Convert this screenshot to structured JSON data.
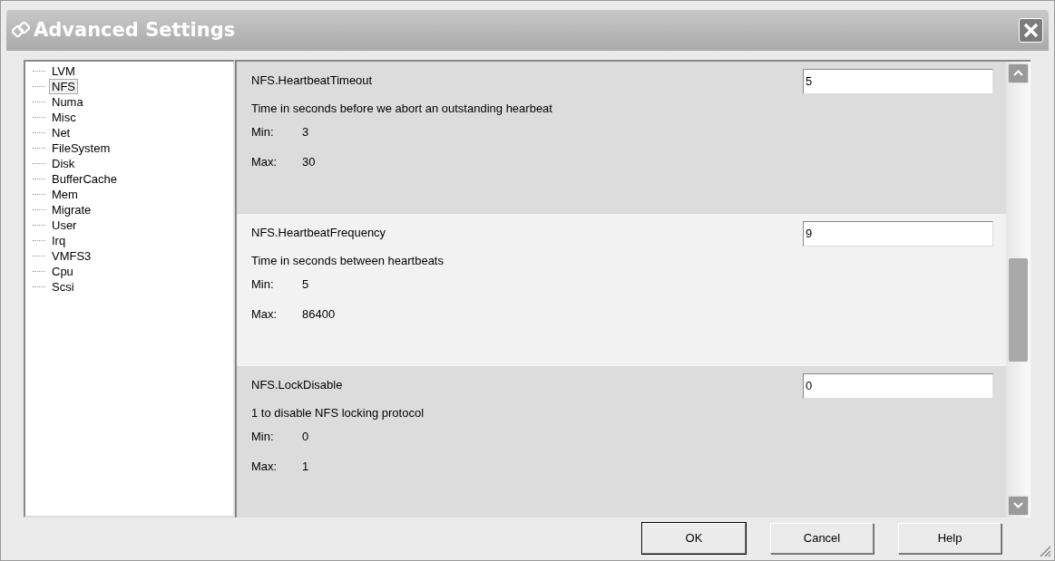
{
  "window": {
    "title": "Advanced Settings"
  },
  "tree": [
    {
      "label": "LVM",
      "selected": false
    },
    {
      "label": "NFS",
      "selected": true
    },
    {
      "label": "Numa",
      "selected": false
    },
    {
      "label": "Misc",
      "selected": false
    },
    {
      "label": "Net",
      "selected": false
    },
    {
      "label": "FileSystem",
      "selected": false
    },
    {
      "label": "Disk",
      "selected": false
    },
    {
      "label": "BufferCache",
      "selected": false
    },
    {
      "label": "Mem",
      "selected": false
    },
    {
      "label": "Migrate",
      "selected": false
    },
    {
      "label": "User",
      "selected": false
    },
    {
      "label": "Irq",
      "selected": false
    },
    {
      "label": "VMFS3",
      "selected": false
    },
    {
      "label": "Cpu",
      "selected": false
    },
    {
      "label": "Scsi",
      "selected": false
    }
  ],
  "settings": [
    {
      "name": "NFS.HeartbeatTimeout",
      "value": "5",
      "description": "Time in seconds before we abort an outstanding hearbeat",
      "min_label": "Min:",
      "min": "3",
      "max_label": "Max:",
      "max": "30"
    },
    {
      "name": "NFS.HeartbeatFrequency",
      "value": "9",
      "description": "Time in seconds between heartbeats",
      "min_label": "Min:",
      "min": "5",
      "max_label": "Max:",
      "max": "86400"
    },
    {
      "name": "NFS.LockDisable",
      "value": "0",
      "description": "1 to disable NFS locking protocol",
      "min_label": "Min:",
      "min": "0",
      "max_label": "Max:",
      "max": "1"
    }
  ],
  "buttons": [
    {
      "label": "OK",
      "default": true
    },
    {
      "label": "Cancel",
      "default": false
    },
    {
      "label": "Help",
      "default": false
    }
  ]
}
